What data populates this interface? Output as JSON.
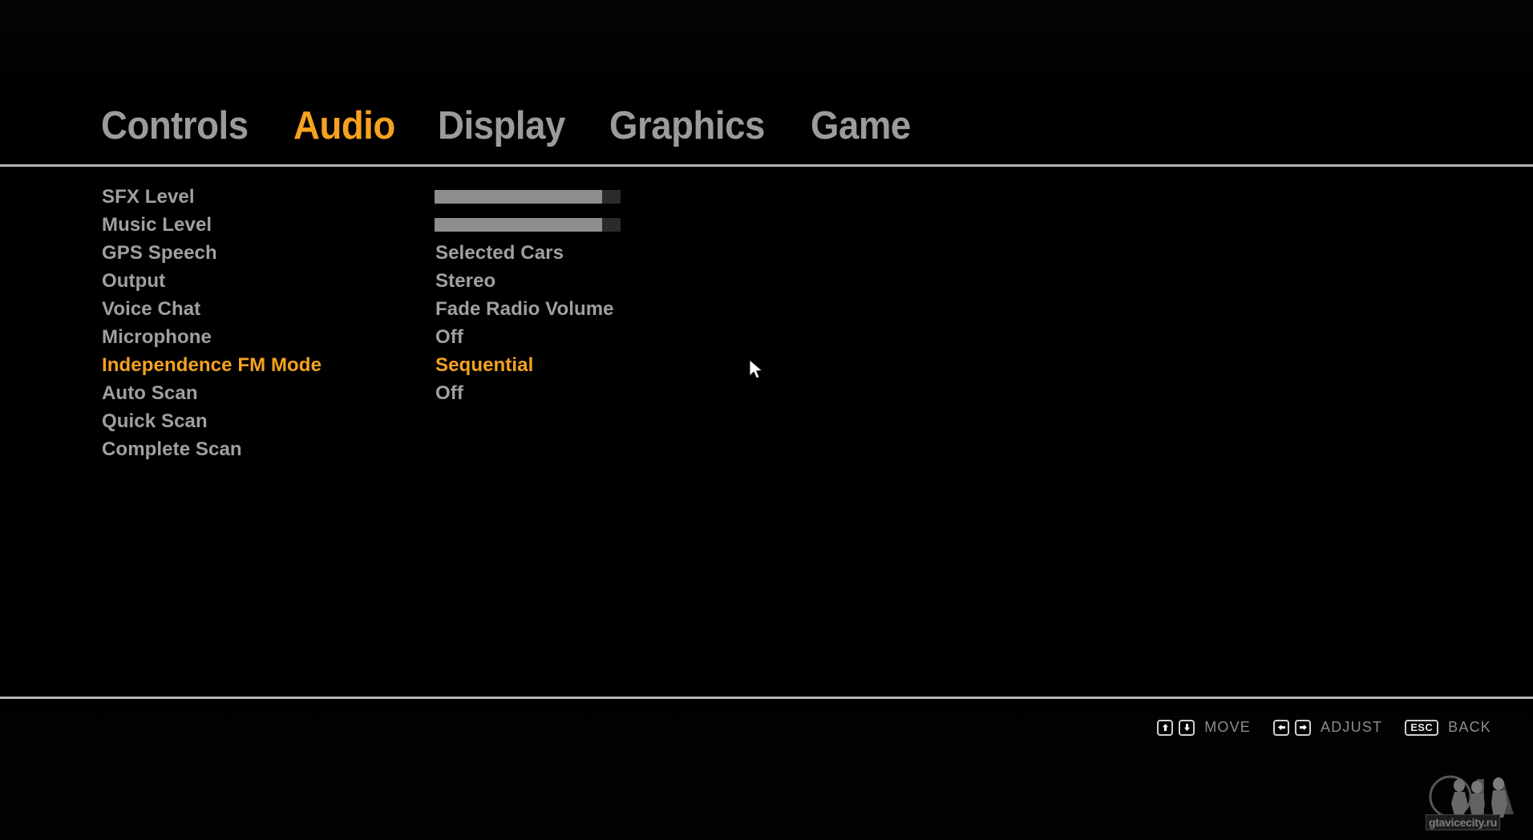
{
  "nav": {
    "tabs": [
      {
        "label": "Controls",
        "active": false
      },
      {
        "label": "Audio",
        "active": true
      },
      {
        "label": "Display",
        "active": false
      },
      {
        "label": "Graphics",
        "active": false
      },
      {
        "label": "Game",
        "active": false
      }
    ]
  },
  "settings": {
    "rows": [
      {
        "label": "SFX Level",
        "type": "slider",
        "value": 90,
        "selected": false
      },
      {
        "label": "Music Level",
        "type": "slider",
        "value": 90,
        "selected": false
      },
      {
        "label": "GPS Speech",
        "type": "text",
        "value": "Selected Cars",
        "selected": false
      },
      {
        "label": "Output",
        "type": "text",
        "value": "Stereo",
        "selected": false
      },
      {
        "label": "Voice Chat",
        "type": "text",
        "value": "Fade Radio Volume",
        "selected": false
      },
      {
        "label": "Microphone",
        "type": "text",
        "value": "Off",
        "selected": false
      },
      {
        "label": "Independence FM Mode",
        "type": "text",
        "value": "Sequential",
        "selected": true
      },
      {
        "label": "Auto Scan",
        "type": "text",
        "value": "Off",
        "selected": false
      },
      {
        "label": "Quick Scan",
        "type": "none",
        "value": "",
        "selected": false
      },
      {
        "label": "Complete Scan",
        "type": "none",
        "value": "",
        "selected": false
      }
    ]
  },
  "footer": {
    "hints": [
      {
        "keys": [
          "arrow-up",
          "arrow-down"
        ],
        "label": "MOVE"
      },
      {
        "keys": [
          "arrow-left",
          "arrow-right"
        ],
        "label": "ADJUST"
      },
      {
        "keys": [
          "ESC"
        ],
        "label": "BACK"
      }
    ]
  },
  "watermark": {
    "text": "gtavicecity.ru"
  },
  "colors": {
    "accent": "#f5a21e",
    "text": "#a0a0a0",
    "rule": "#b4b4b4",
    "slider_fill": "#8e8e8e",
    "slider_track": "#2b2b2b",
    "background": "#000000"
  }
}
